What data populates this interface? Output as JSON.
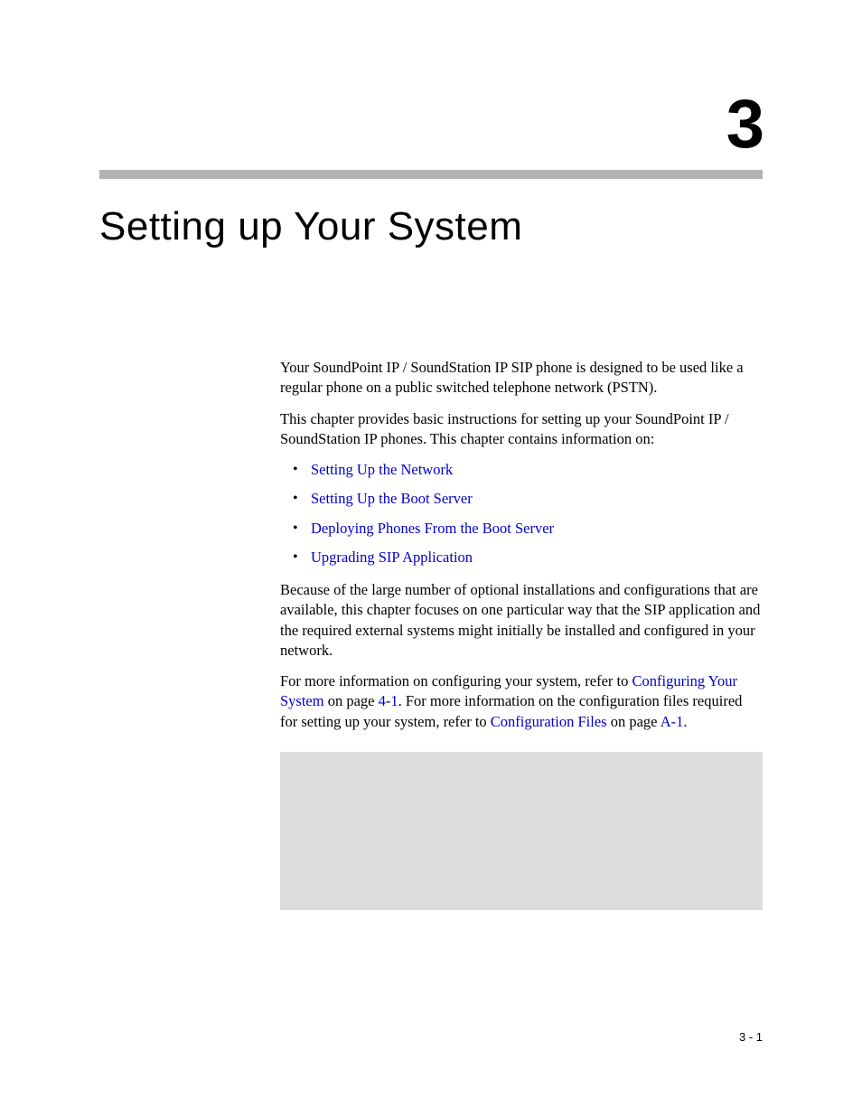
{
  "chapter": {
    "number": "3",
    "title": "Setting up Your System"
  },
  "paragraphs": {
    "intro1": "Your SoundPoint IP / SoundStation IP SIP phone is designed to be used like a regular phone on a public switched telephone network (PSTN).",
    "intro2": "This chapter provides basic instructions for setting up your SoundPoint IP / SoundStation IP phones. This chapter contains information on:",
    "para3": "Because of the large number of optional installations and configurations that are available, this chapter focuses on one particular way that the SIP application and the required external systems might initially be installed and configured in your network.",
    "para4_pre": "For more information on configuring your system, refer to ",
    "para4_link1": "Configuring Your System",
    "para4_mid1": " on page ",
    "para4_link2": "4-1",
    "para4_mid2": ". For more information on the configuration files required for setting up your system, refer to ",
    "para4_link3": "Configuration Files",
    "para4_mid3": " on page ",
    "para4_link4": "A-1",
    "para4_end": "."
  },
  "toc": [
    "Setting Up the Network",
    "Setting Up the Boot Server",
    "Deploying Phones From the Boot Server",
    "Upgrading SIP Application"
  ],
  "footer": {
    "page": "3 - 1"
  }
}
